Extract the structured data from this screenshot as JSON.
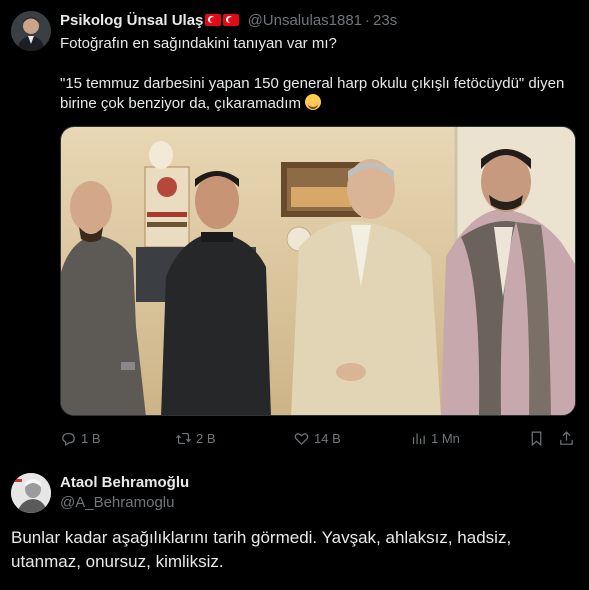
{
  "tweet": {
    "author_name": "Psikolog Ünsal Ulaş",
    "author_flags": "turkey-flag-icon",
    "handle": "@Unsalulas1881",
    "separator": "·",
    "time": "23s",
    "text_line1": "Fotoğrafın en sağındakini tanıyan var mı?",
    "text_line2": "\"15 temmuz darbesini yapan 150 general harp okulu çıkışlı fetöcüydü\" diyen birine çok benziyor da, çıkaramadım",
    "emoji": "smiling-face-emoji",
    "image": {
      "description_icon": "photo-of-four-men"
    },
    "stats": {
      "replies": "1 B",
      "reposts": "2 B",
      "likes": "14 B",
      "views": "1 Mn"
    }
  },
  "reply": {
    "author_name": "Ataol Behramoğlu",
    "handle": "@A_Behramoglu",
    "text": "Bunlar kadar aşağılıklarını tarih görmedi. Yavşak, ahlaksız, hadsiz, utanmaz, onursuz, kimliksiz."
  },
  "colors": {
    "background": "#000000",
    "text_primary": "#e7e9ea",
    "text_secondary": "#71767b",
    "border": "#2f3336"
  }
}
